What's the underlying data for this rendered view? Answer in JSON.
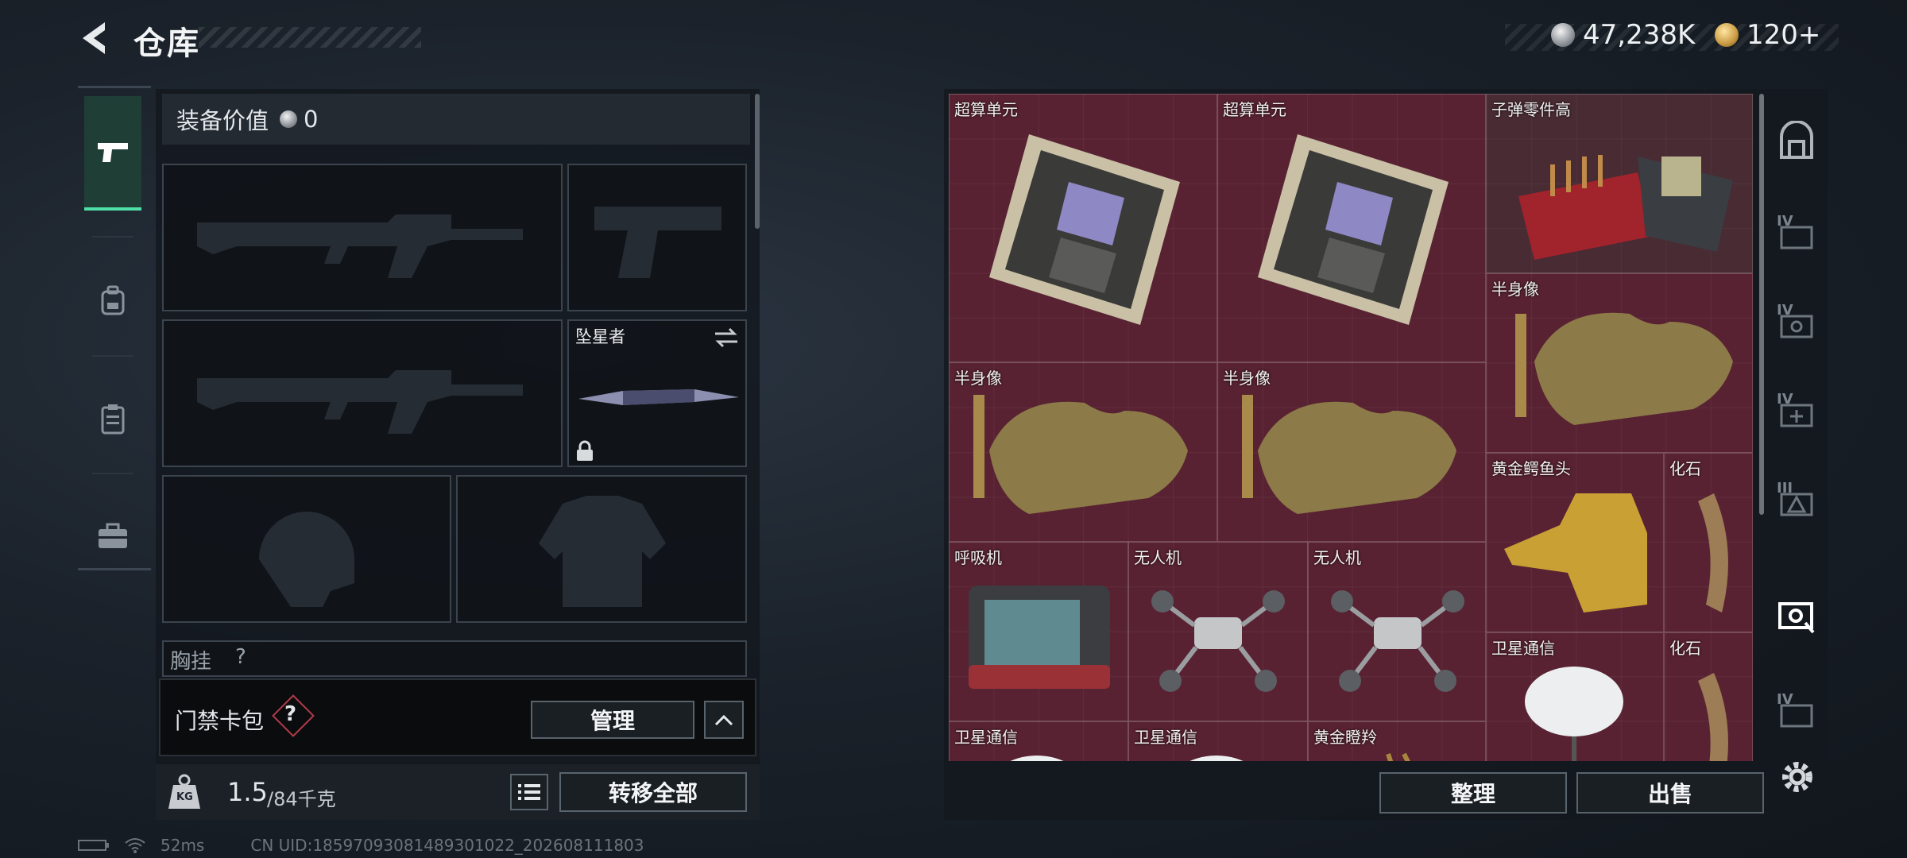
{
  "header": {
    "title": "仓库"
  },
  "currency": [
    {
      "icon": "silver-coin-icon",
      "value": "47,238K"
    },
    {
      "icon": "gold-triangle-coin-icon",
      "value": "120+"
    }
  ],
  "left_rail": [
    {
      "icon": "pistol-icon",
      "active": true
    },
    {
      "icon": "backpack-icon",
      "active": false
    },
    {
      "icon": "clipboard-icon",
      "active": false
    },
    {
      "icon": "toolbox-icon",
      "active": false
    }
  ],
  "equipment": {
    "value_label": "装备价值",
    "value": "0",
    "melee_name": "坠星者",
    "chest_label": "胸挂",
    "chest_hint": "?"
  },
  "card_pack": {
    "label": "门禁卡包",
    "help": "?",
    "manage": "管理"
  },
  "capacity": {
    "current": "1.5",
    "max": "/84千克",
    "unit_badge": "KG",
    "transfer_all": "转移全部"
  },
  "storage": {
    "items": [
      {
        "name": "超算单元",
        "quality": "red",
        "icon": "circuit-board-icon"
      },
      {
        "name": "超算单元",
        "quality": "red",
        "icon": "circuit-board-icon"
      },
      {
        "name": "子弹零件高",
        "quality": "neutral",
        "icon": "ammo-parts-icon"
      },
      {
        "name": "半身像",
        "quality": "red",
        "icon": "bust-statue-icon"
      },
      {
        "name": "半身像",
        "quality": "red",
        "icon": "bust-statue-icon"
      },
      {
        "name": "半身像",
        "quality": "red",
        "icon": "bust-statue-icon"
      },
      {
        "name": "黄金鳄鱼头",
        "quality": "red",
        "icon": "gold-crocodile-head-icon"
      },
      {
        "name": "化石",
        "quality": "red",
        "icon": "fossil-claw-icon"
      },
      {
        "name": "呼吸机",
        "quality": "red",
        "icon": "ventilator-icon"
      },
      {
        "name": "无人机",
        "quality": "red",
        "icon": "drone-icon"
      },
      {
        "name": "无人机",
        "quality": "red",
        "icon": "drone-icon"
      },
      {
        "name": "卫星通信",
        "quality": "red",
        "icon": "satellite-dish-icon"
      },
      {
        "name": "化石",
        "quality": "red",
        "icon": "fossil-claw-icon"
      },
      {
        "name": "卫星通信",
        "quality": "red",
        "icon": "satellite-dish-icon"
      },
      {
        "name": "卫星通信",
        "quality": "red",
        "icon": "satellite-dish-icon"
      },
      {
        "name": "黄金瞪羚",
        "quality": "red",
        "icon": "gold-gazelle-icon"
      }
    ],
    "sort": "整理",
    "sell": "出售"
  },
  "right_rail_icons": [
    "locker-icon",
    "storage-tab-4-icon",
    "storage-tab-4-safe-icon",
    "storage-tab-4-plus-icon",
    "storage-tab-3-icon",
    "storage-tab-active-icon",
    "storage-tab-4b-icon",
    "settings-gear-icon"
  ],
  "right_rail_labels": [
    "IV",
    "IV",
    "IV",
    "III",
    "IV"
  ],
  "status": {
    "ping": "52ms",
    "uid": "CN UID:18597093081489301022_202608111803"
  },
  "colors": {
    "accent": "#4ee0a6",
    "item_red": "#512230"
  }
}
